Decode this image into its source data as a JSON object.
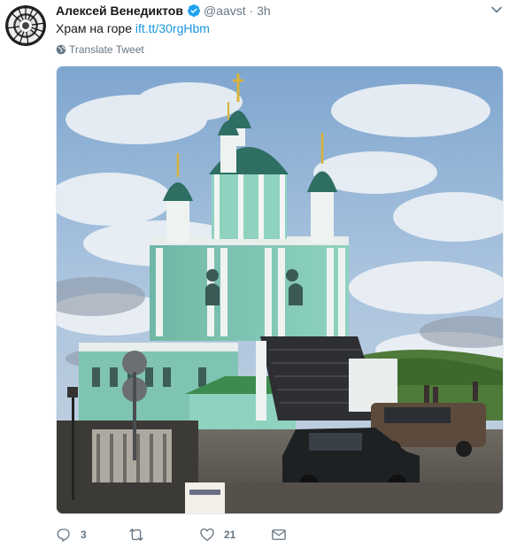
{
  "tweet": {
    "author_name": "Алексей Венедиктов",
    "handle": "@aavst",
    "separator": "·",
    "time": "3h",
    "text": "Храм на горе",
    "link_text": "ift.tt/30rgHbm",
    "translate_label": "Translate Tweet",
    "photo_alt": "Храм на горе"
  },
  "actions": {
    "reply_count": "3",
    "retweet_count": "",
    "like_count": "21"
  },
  "colors": {
    "link": "#1b95e0",
    "verified": "#1da1f2",
    "secondary": "#657786"
  }
}
